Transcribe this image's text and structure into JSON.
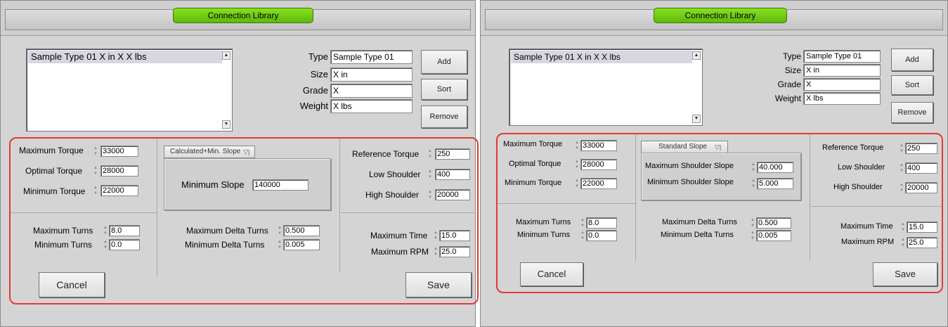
{
  "left": {
    "title": "Connection Library",
    "list": {
      "items": [
        "Sample Type 01 X in X X lbs"
      ]
    },
    "props": {
      "type": {
        "label": "Type",
        "value": "Sample Type 01"
      },
      "size": {
        "label": "Size",
        "value": "X in"
      },
      "grade": {
        "label": "Grade",
        "value": "X"
      },
      "weight": {
        "label": "Weight",
        "value": "X lbs"
      }
    },
    "buttons": {
      "add": "Add",
      "sort": "Sort",
      "remove": "Remove",
      "cancel": "Cancel",
      "save": "Save"
    },
    "torque": {
      "max_label": "Maximum Torque",
      "max_value": "33000",
      "opt_label": "Optimal Torque",
      "opt_value": "28000",
      "min_label": "Minimum Torque",
      "min_value": "22000"
    },
    "slope": {
      "mode": "Calculated+Min. Slope",
      "min_slope_label": "Minimum Slope",
      "min_slope_value": "140000"
    },
    "reference": {
      "ref_label": "Reference Torque",
      "ref_value": "250",
      "low_label": "Low Shoulder",
      "low_value": "400",
      "high_label": "High Shoulder",
      "high_value": "20000"
    },
    "turns": {
      "max_label": "Maximum Turns",
      "max_value": "8.0",
      "min_label": "Minimum Turns",
      "min_value": "0.0"
    },
    "delta": {
      "max_label": "Maximum Delta Turns",
      "max_value": "0.500",
      "min_label": "Minimum Delta Turns",
      "min_value": "0.005"
    },
    "time": {
      "time_label": "Maximum Time",
      "time_value": "15.0",
      "rpm_label": "Maximum RPM",
      "rpm_value": "25.0"
    }
  },
  "right": {
    "title": "Connection Library",
    "list": {
      "items": [
        "Sample Type 01 X in X X lbs"
      ]
    },
    "props": {
      "type": {
        "label": "Type",
        "value": "Sample Type 01"
      },
      "size": {
        "label": "Size",
        "value": "X in"
      },
      "grade": {
        "label": "Grade",
        "value": "X"
      },
      "weight": {
        "label": "Weight",
        "value": "X lbs"
      }
    },
    "buttons": {
      "add": "Add",
      "sort": "Sort",
      "remove": "Remove",
      "cancel": "Cancel",
      "save": "Save"
    },
    "torque": {
      "max_label": "Maximum Torque",
      "max_value": "33000",
      "opt_label": "Optimal Torque",
      "opt_value": "28000",
      "min_label": "Minimum Torque",
      "min_value": "22000"
    },
    "slope": {
      "mode": "Standard Slope",
      "max_shoulder_label": "Maximum Shoulder Slope",
      "max_shoulder_value": "40.000",
      "min_shoulder_label": "Minimum Shoulder Slope",
      "min_shoulder_value": "5.000"
    },
    "reference": {
      "ref_label": "Reference Torque",
      "ref_value": "250",
      "low_label": "Low Shoulder",
      "low_value": "400",
      "high_label": "High Shoulder",
      "high_value": "20000"
    },
    "turns": {
      "max_label": "Maximum Turns",
      "max_value": "8.0",
      "min_label": "Minimum Turns",
      "min_value": "0.0"
    },
    "delta": {
      "max_label": "Maximum Delta Turns",
      "max_value": "0.500",
      "min_label": "Minimum Delta Turns",
      "min_value": "0.005"
    },
    "time": {
      "time_label": "Maximum Time",
      "time_value": "15.0",
      "rpm_label": "Maximum RPM",
      "rpm_value": "25.0"
    }
  },
  "colors": {
    "title_pill": "#6cc817",
    "highlight_outline": "#e53935",
    "panel_bg": "#d4d4d4"
  },
  "icons": [
    "spin-arrows-icon",
    "dropdown-arrow-icon",
    "scroll-up-icon",
    "scroll-down-icon"
  ]
}
